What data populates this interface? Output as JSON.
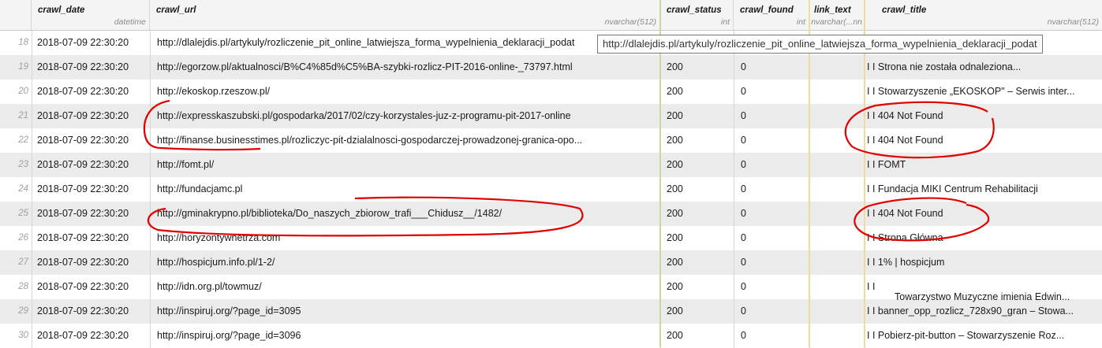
{
  "columns": [
    {
      "name": "crawl_date",
      "type": "datetime"
    },
    {
      "name": "crawl_url",
      "type": "nvarchar(512)"
    },
    {
      "name": "crawl_status",
      "type": "int"
    },
    {
      "name": "crawl_found",
      "type": "int"
    },
    {
      "name": "link_text",
      "type": "nvarchar(...nn"
    },
    {
      "name": "crawl_title",
      "type": "nvarchar(512)"
    }
  ],
  "rows": [
    {
      "num": "18",
      "date": "2018-07-09 22:30:20",
      "url": "http://dlalejdis.pl/artykuly/rozliczenie_pit_online_latwiejsza_forma_wypelnienia_deklaracji_podat",
      "status": "",
      "found": "",
      "link": "",
      "title": ""
    },
    {
      "num": "19",
      "date": "2018-07-09 22:30:20",
      "url": "http://egorzow.pl/aktualnosci/B%C4%85d%C5%BA-szybki-rozlicz-PIT-2016-online-_73797.html",
      "status": "200",
      "found": "0",
      "link": "",
      "title": "I I Strona nie została odnaleziona..."
    },
    {
      "num": "20",
      "date": "2018-07-09 22:30:20",
      "url": "http://ekoskop.rzeszow.pl/",
      "status": "200",
      "found": "0",
      "link": "",
      "title": "I I Stowarzyszenie „EKOSKOP\" – Serwis inter..."
    },
    {
      "num": "21",
      "date": "2018-07-09 22:30:20",
      "url": "http://expresskaszubski.pl/gospodarka/2017/02/czy-korzystales-juz-z-programu-pit-2017-online",
      "status": "200",
      "found": "0",
      "link": "",
      "title": "I I 404 Not Found"
    },
    {
      "num": "22",
      "date": "2018-07-09 22:30:20",
      "url": "http://finanse.businesstimes.pl/rozliczyc-pit-dzialalnosci-gospodarczej-prowadzonej-granica-opo...",
      "status": "200",
      "found": "0",
      "link": "",
      "title": "I I 404 Not Found"
    },
    {
      "num": "23",
      "date": "2018-07-09 22:30:20",
      "url": "http://fomt.pl/",
      "status": "200",
      "found": "0",
      "link": "",
      "title": "I I FOMT"
    },
    {
      "num": "24",
      "date": "2018-07-09 22:30:20",
      "url": "http://fundacjamc.pl",
      "status": "200",
      "found": "0",
      "link": "",
      "title": "I I Fundacja MIKI Centrum Rehabilitacji"
    },
    {
      "num": "25",
      "date": "2018-07-09 22:30:20",
      "url": "http://gminakrypno.pl/biblioteka/Do_naszych_zbiorow_trafi___Chidusz__/1482/",
      "status": "200",
      "found": "0",
      "link": "",
      "title": "I I 404 Not Found"
    },
    {
      "num": "26",
      "date": "2018-07-09 22:30:20",
      "url": "http://horyzontywnetrza.com",
      "status": "200",
      "found": "0",
      "link": "",
      "title": "I I Strona Główna"
    },
    {
      "num": "27",
      "date": "2018-07-09 22:30:20",
      "url": "http://hospicjum.info.pl/1-2/",
      "status": "200",
      "found": "0",
      "link": "",
      "title": "I I 1% | hospicjum"
    },
    {
      "num": "28",
      "date": "2018-07-09 22:30:20",
      "url": "http://idn.org.pl/towmuz/",
      "status": "200",
      "found": "0",
      "link": "",
      "title": "I I"
    },
    {
      "num": "29",
      "date": "2018-07-09 22:30:20",
      "url": "http://inspiruj.org/?page_id=3095",
      "status": "200",
      "found": "0",
      "link": "",
      "title": "I I banner_opp_rozlicz_728x90_gran – Stowa..."
    },
    {
      "num": "30",
      "date": "2018-07-09 22:30:20",
      "url": "http://inspiruj.org/?page_id=3096",
      "status": "200",
      "found": "0",
      "link": "",
      "title": "I I Pobierz-pit-button – Stowarzyszenie Roz..."
    }
  ],
  "row28_title_extra": "Towarzystwo Muzyczne imienia Edwin...",
  "tooltip": "http://dlalejdis.pl/artykuly/rozliczenie_pit_online_latwiejsza_forma_wypelnienia_deklaracji_podat",
  "colors": {
    "header_bg": "#f4f4f4",
    "alt_row_bg": "#ebebeb",
    "annotation": "#e00000"
  }
}
